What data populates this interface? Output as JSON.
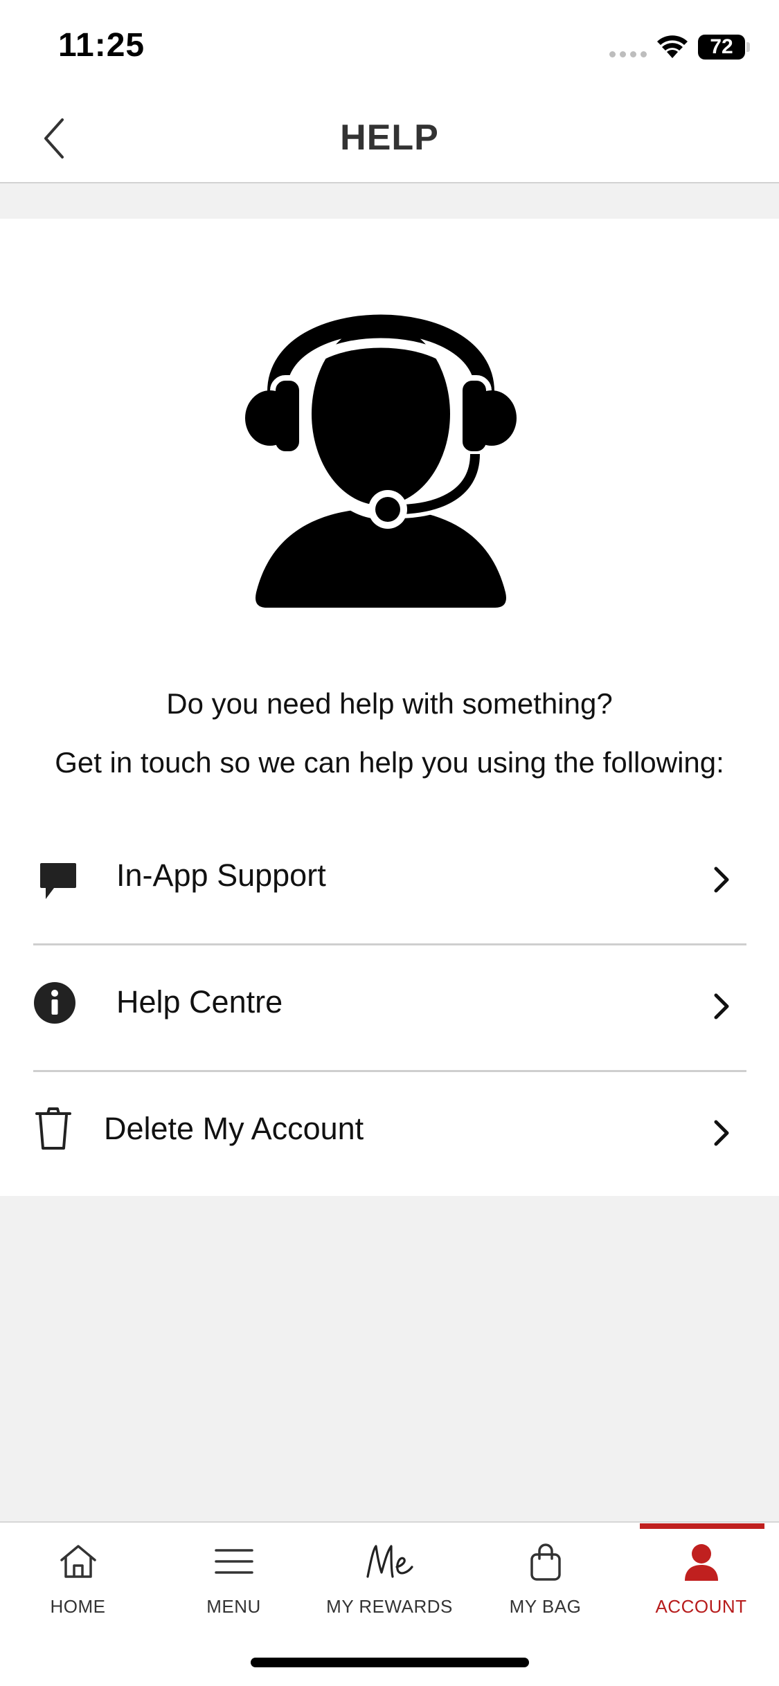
{
  "status_bar": {
    "time": "11:25",
    "battery": "72"
  },
  "header": {
    "title": "HELP"
  },
  "intro": {
    "question": "Do you need help with something?",
    "instruction": "Get in touch so we can help you using the following:"
  },
  "menu": [
    {
      "label": "In-App Support",
      "icon": "chat-bubble-icon"
    },
    {
      "label": "Help Centre",
      "icon": "info-icon"
    },
    {
      "label": "Delete My Account",
      "icon": "trash-icon"
    }
  ],
  "tabs": [
    {
      "label": "HOME",
      "icon": "home-icon"
    },
    {
      "label": "MENU",
      "icon": "menu-icon"
    },
    {
      "label": "MY REWARDS",
      "icon": "rewards-icon"
    },
    {
      "label": "MY BAG",
      "icon": "bag-icon"
    },
    {
      "label": "ACCOUNT",
      "icon": "account-icon",
      "active": true
    }
  ],
  "colors": {
    "accent": "#c0201f",
    "background": "#f1f1f1",
    "divider": "#cfcfcf"
  }
}
